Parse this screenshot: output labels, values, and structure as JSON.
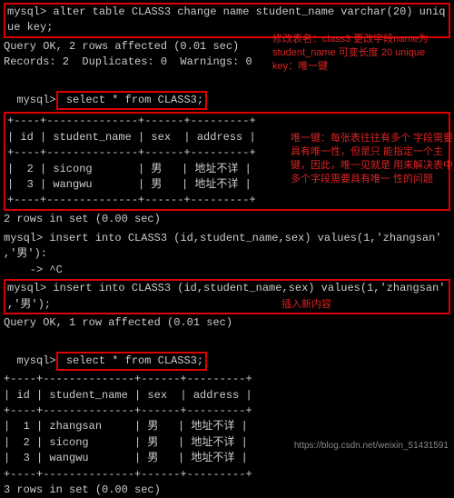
{
  "prompt": "mysql>",
  "cmd1": " alter table CLASS3 change name student_name varchar(20) uniq\nue key;",
  "res1a": "Query OK, 2 rows affected (0.01 sec)",
  "res1b": "Records: 2  Duplicates: 0  Warnings: 0",
  "cmd2": " select * from CLASS3;",
  "table1": {
    "sep": "+----+--------------+------+---------+",
    "hdr": "| id | student_name | sex  | address |",
    "r1": "|  2 | sicong       | 男   | 地址不详 |",
    "r2": "|  3 | wangwu       | 男   | 地址不详 |"
  },
  "res2": "2 rows in set (0.00 sec)",
  "cmd3": " insert into CLASS3 (id,student_name,sex) values(1,'zhangsan'\n,'男'):",
  "cont": "    -> ^C",
  "cmd4": " insert into CLASS3 (id,student_name,sex) values(1,'zhangsan'\n,'男');",
  "res4": "Query OK, 1 row affected (0.01 sec)",
  "cmd5": " select * from CLASS3;",
  "table2": {
    "sep": "+----+--------------+------+---------+",
    "hdr": "| id | student_name | sex  | address |",
    "r1": "|  1 | zhangsan     | 男   | 地址不详 |",
    "r2": "|  2 | sicong       | 男   | 地址不详 |",
    "r3": "|  3 | wangwu       | 男   | 地址不详 |"
  },
  "res5": "3 rows in set (0.00 sec)",
  "annot1": "修改表名：class3 更改字段name为\nstudent_name 可变长度 20 unique\nkey：唯一键",
  "annot2": "唯一键：每张表往往有多个\n字段需要具有唯一性，但是只\n能指定一个主键，因此，唯一见就是\n用来解决表中多个字段需要具有唯一\n性的问题",
  "annot3": "插入新内容",
  "watermark": "https://blog.csdn.net/weixin_51431591"
}
